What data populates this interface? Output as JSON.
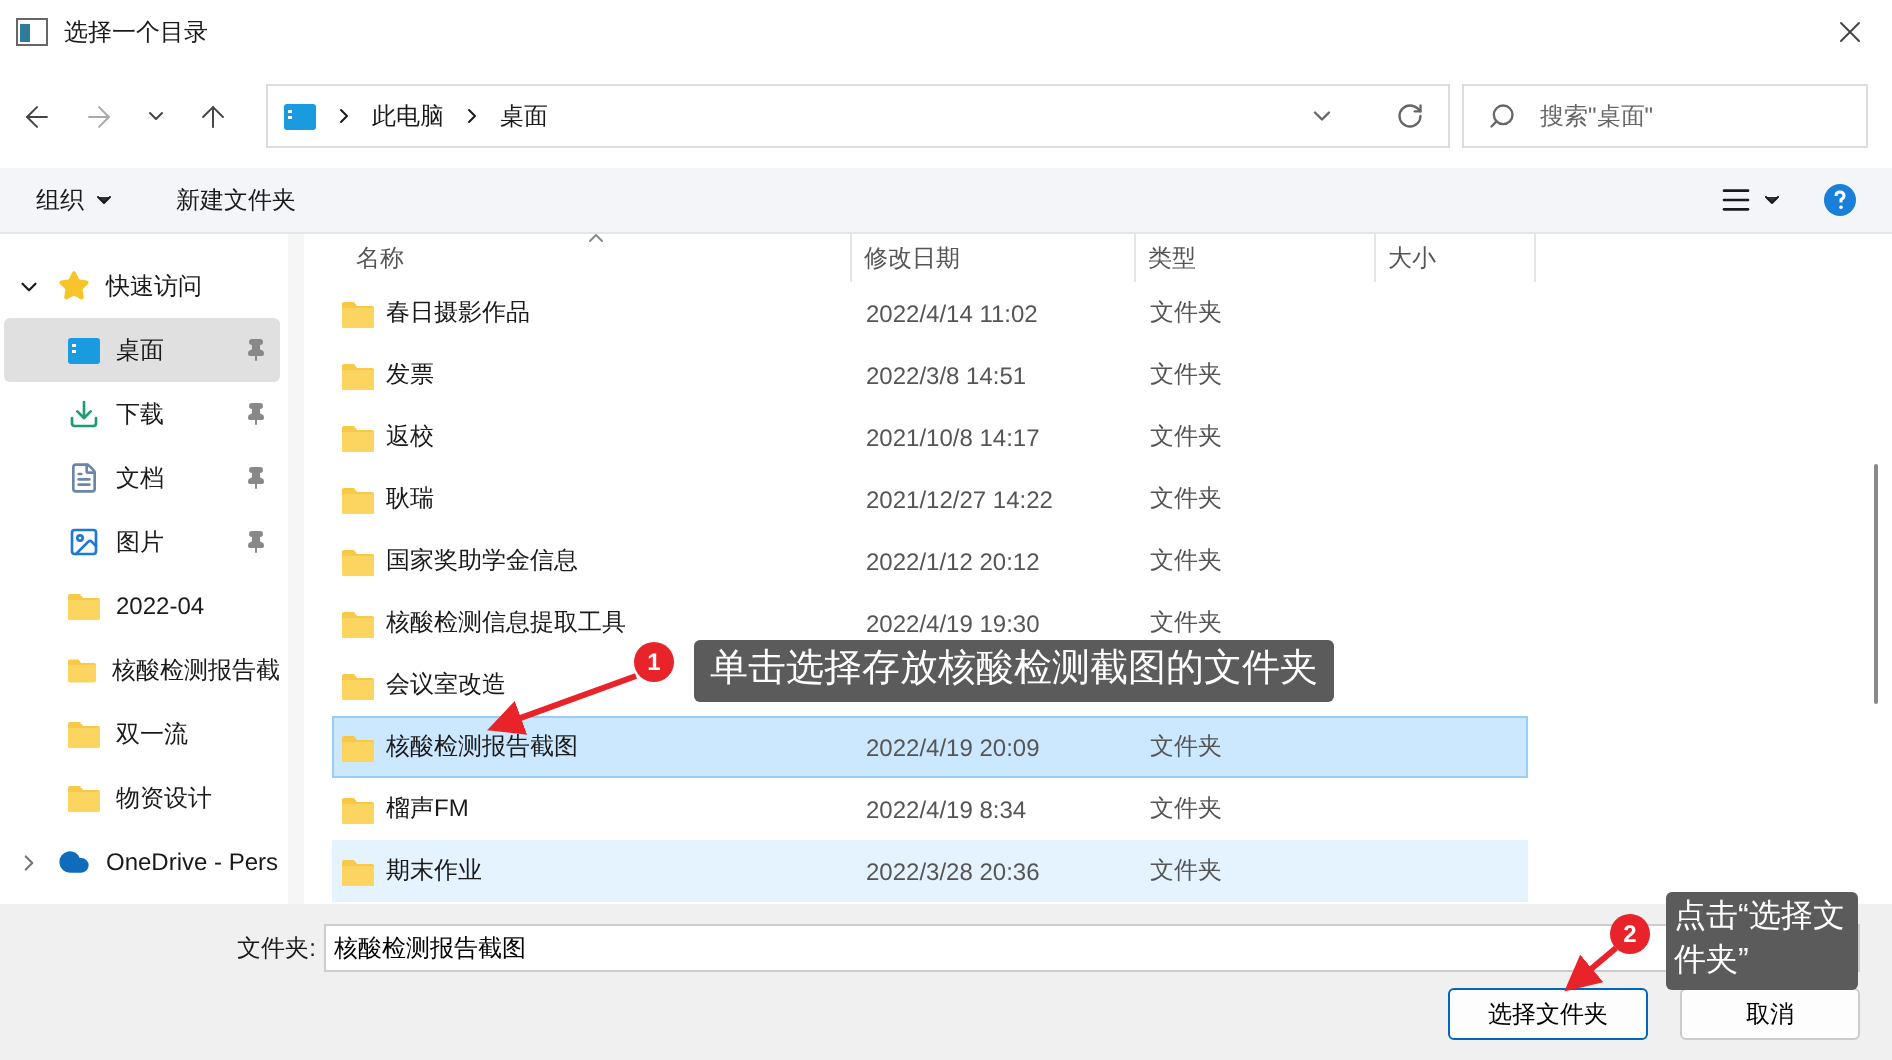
{
  "window": {
    "title": "选择一个目录"
  },
  "address": {
    "crumbs": [
      "此电脑",
      "桌面"
    ],
    "search_placeholder": "搜索\"桌面\""
  },
  "toolbar": {
    "organize": "组织",
    "new_folder": "新建文件夹"
  },
  "sidebar": {
    "items": [
      {
        "label": "快速访问",
        "kind": "star",
        "expanded": true,
        "selected": false,
        "children": [
          {
            "label": "桌面",
            "kind": "desktop",
            "pinned": true,
            "selected": true
          },
          {
            "label": "下载",
            "kind": "download",
            "pinned": true,
            "selected": false
          },
          {
            "label": "文档",
            "kind": "document",
            "pinned": true,
            "selected": false
          },
          {
            "label": "图片",
            "kind": "picture",
            "pinned": true,
            "selected": false
          },
          {
            "label": "2022-04",
            "kind": "folder",
            "pinned": false,
            "selected": false
          },
          {
            "label": "核酸检测报告截",
            "kind": "folder",
            "pinned": false,
            "selected": false
          },
          {
            "label": "双一流",
            "kind": "folder",
            "pinned": false,
            "selected": false
          },
          {
            "label": "物资设计",
            "kind": "folder",
            "pinned": false,
            "selected": false
          }
        ]
      },
      {
        "label": "OneDrive - Pers",
        "kind": "cloud",
        "expanded": false,
        "selected": false
      }
    ]
  },
  "table": {
    "columns": [
      "名称",
      "修改日期",
      "类型",
      "大小"
    ],
    "rows": [
      {
        "name": "春日摄影作品",
        "date": "2022/4/14 11:02",
        "type": "文件夹",
        "selected": false,
        "hovered": false
      },
      {
        "name": "发票",
        "date": "2022/3/8 14:51",
        "type": "文件夹",
        "selected": false,
        "hovered": false
      },
      {
        "name": "返校",
        "date": "2021/10/8 14:17",
        "type": "文件夹",
        "selected": false,
        "hovered": false
      },
      {
        "name": "耿瑞",
        "date": "2021/12/27 14:22",
        "type": "文件夹",
        "selected": false,
        "hovered": false
      },
      {
        "name": "国家奖助学金信息",
        "date": "2022/1/12 20:12",
        "type": "文件夹",
        "selected": false,
        "hovered": false
      },
      {
        "name": "核酸检测信息提取工具",
        "date": "2022/4/19 19:30",
        "type": "文件夹",
        "selected": false,
        "hovered": false
      },
      {
        "name": "会议室改造",
        "selected": false,
        "hovered": false
      },
      {
        "name": "核酸检测报告截图",
        "date": "2022/4/19 20:09",
        "type": "文件夹",
        "selected": true,
        "hovered": false
      },
      {
        "name": "榴声FM",
        "date": "2022/4/19 8:34",
        "type": "文件夹",
        "selected": false,
        "hovered": false
      },
      {
        "name": "期末作业",
        "date": "2022/3/28 20:36",
        "type": "文件夹",
        "selected": false,
        "hovered": true
      }
    ]
  },
  "footer": {
    "folder_label": "文件夹:",
    "folder_value": "核酸检测报告截图",
    "buttons": [
      {
        "label": "选择文件夹",
        "primary": true
      },
      {
        "label": "取消",
        "primary": false
      }
    ]
  },
  "annotations": [
    {
      "number": "1",
      "text": "单击选择存放核酸检测截图的文件夹"
    },
    {
      "number": "2",
      "text": "点击“选择文件夹”"
    }
  ]
}
